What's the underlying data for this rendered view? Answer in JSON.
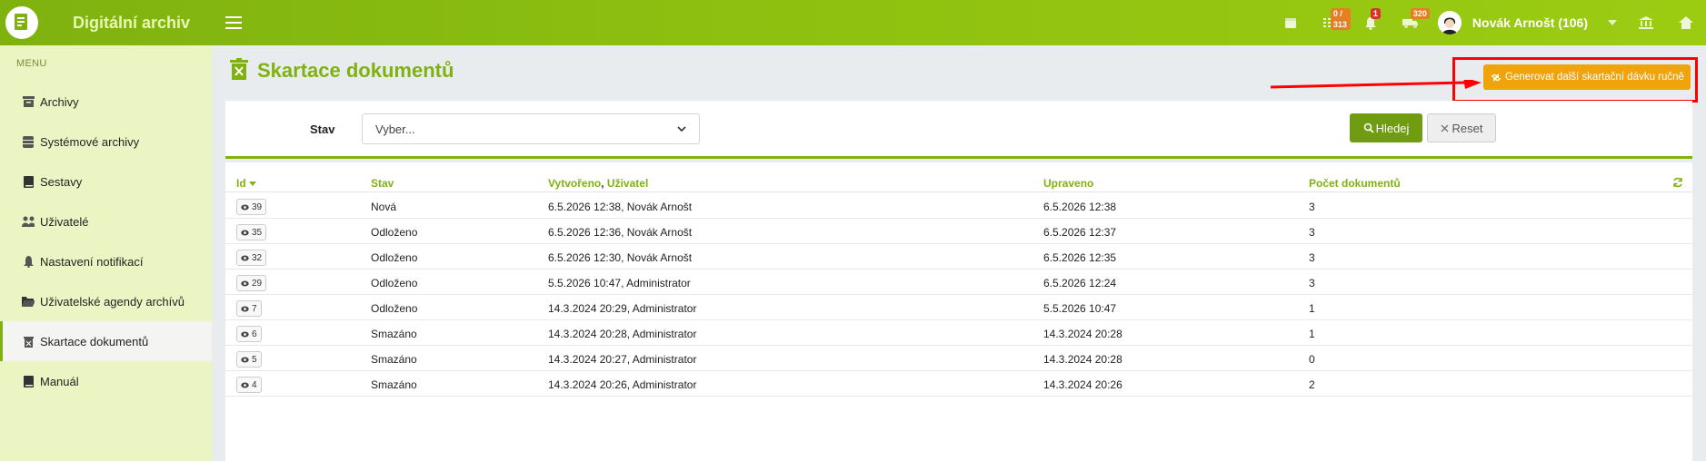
{
  "app": {
    "title": "Digitální archiv"
  },
  "topbar": {
    "icons": [
      {
        "name": "calendar-icon",
        "badge": ""
      },
      {
        "name": "task-list-icon",
        "badge": "0 / 313"
      },
      {
        "name": "bell-icon",
        "badge": "1"
      },
      {
        "name": "truck-icon",
        "badge": "320"
      }
    ],
    "user": "Novák Arnošt (106)"
  },
  "sidebar": {
    "menu_label": "MENU",
    "items": [
      {
        "label": "Archivy",
        "icon": "archive-icon"
      },
      {
        "label": "Systémové archivy",
        "icon": "database-icon"
      },
      {
        "label": "Sestavy",
        "icon": "book-icon"
      },
      {
        "label": "Uživatelé",
        "icon": "users-icon"
      },
      {
        "label": "Nastavení notifikací",
        "icon": "bell-icon"
      },
      {
        "label": "Uživatelské agendy archívů",
        "icon": "folder-open-icon"
      },
      {
        "label": "Skartace dokumentů",
        "icon": "trash-icon",
        "active": true
      },
      {
        "label": "Manuál",
        "icon": "book-icon"
      }
    ]
  },
  "page": {
    "title": "Skartace dokumentů",
    "generate_button": "Generovat další skartační dávku ručně"
  },
  "filter": {
    "label": "Stav",
    "select_value": "Vyber...",
    "search_button": "Hledej",
    "reset_button": "Reset"
  },
  "table": {
    "headers": {
      "id": "Id",
      "stav": "Stav",
      "vytvoreno": "Vytvořeno",
      "uzivatel": "Uživatel",
      "upraveno": "Upraveno",
      "pocet": "Počet dokumentů"
    },
    "rows": [
      {
        "id": "39",
        "stav": "Nová",
        "vytvoreno": "6.5.2026 12:38, Novák Arnošt",
        "upraveno": "6.5.2026 12:38",
        "pocet": "3"
      },
      {
        "id": "35",
        "stav": "Odloženo",
        "vytvoreno": "6.5.2026 12:36, Novák Arnošt",
        "upraveno": "6.5.2026 12:37",
        "pocet": "3"
      },
      {
        "id": "32",
        "stav": "Odloženo",
        "vytvoreno": "6.5.2026 12:30, Novák Arnošt",
        "upraveno": "6.5.2026 12:35",
        "pocet": "3"
      },
      {
        "id": "29",
        "stav": "Odloženo",
        "vytvoreno": "5.5.2026 10:47, Administrator",
        "upraveno": "6.5.2026 12:24",
        "pocet": "3"
      },
      {
        "id": "7",
        "stav": "Odloženo",
        "vytvoreno": "14.3.2024 20:29, Administrator",
        "upraveno": "5.5.2026 10:47",
        "pocet": "1"
      },
      {
        "id": "6",
        "stav": "Smazáno",
        "vytvoreno": "14.3.2024 20:28, Administrator",
        "upraveno": "14.3.2024 20:28",
        "pocet": "1"
      },
      {
        "id": "5",
        "stav": "Smazáno",
        "vytvoreno": "14.3.2024 20:27, Administrator",
        "upraveno": "14.3.2024 20:28",
        "pocet": "0"
      },
      {
        "id": "4",
        "stav": "Smazáno",
        "vytvoreno": "14.3.2024 20:26, Administrator",
        "upraveno": "14.3.2024 20:26",
        "pocet": "2"
      }
    ]
  },
  "colors": {
    "brand_green": "#7fb20f",
    "sidebar_bg": "#eaf5c3",
    "generate_button": "#f0a30a",
    "annotation_red": "#ff0000"
  }
}
